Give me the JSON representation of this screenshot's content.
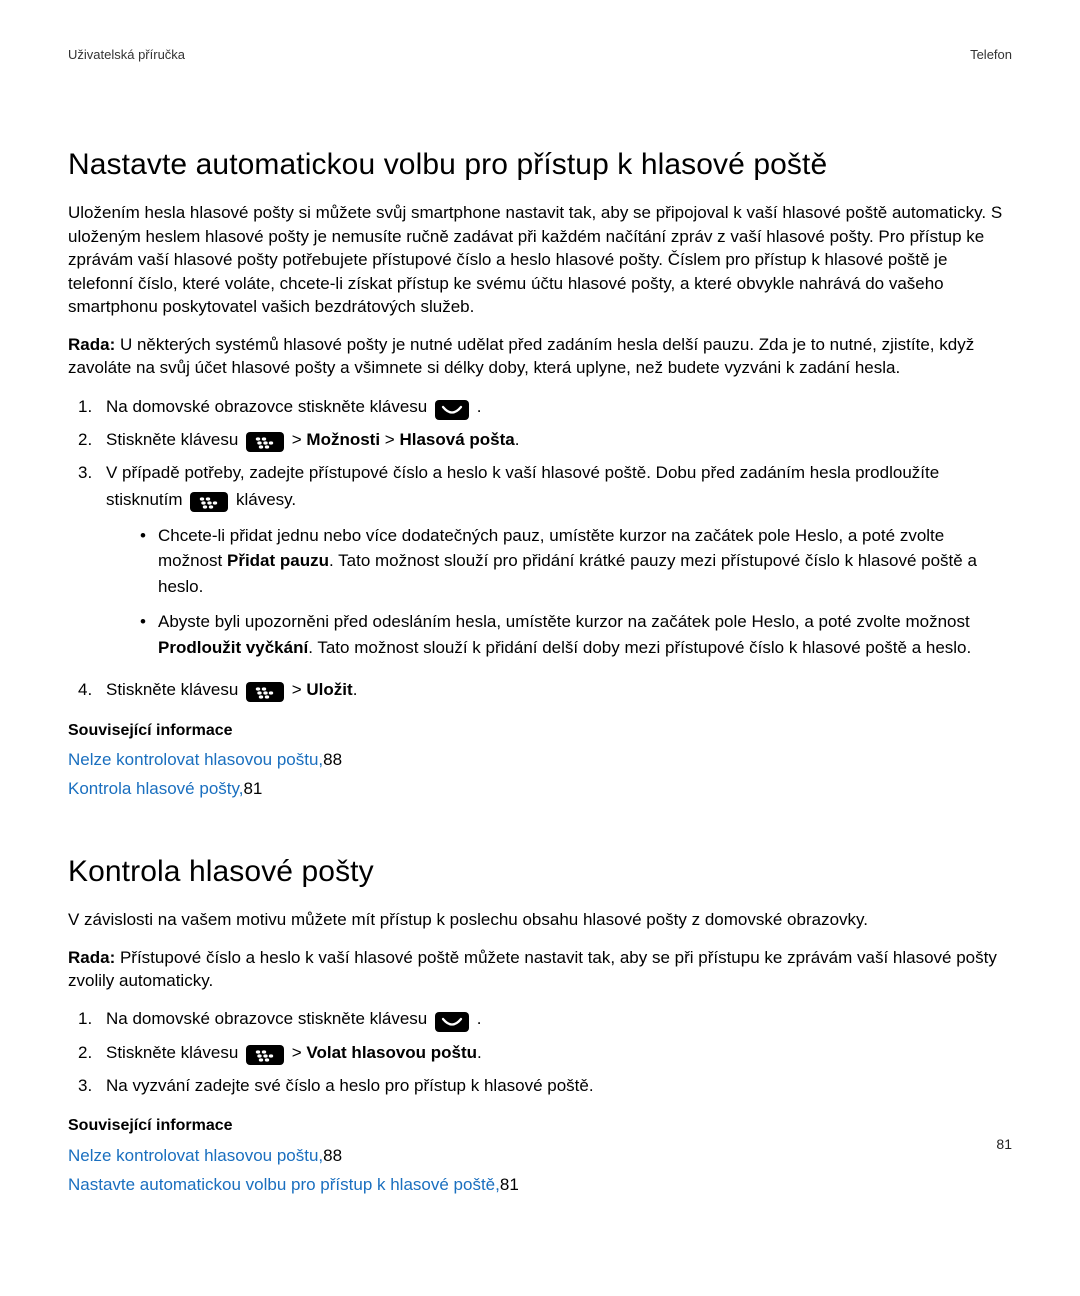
{
  "header": {
    "left": "Uživatelská příručka",
    "right": "Telefon"
  },
  "section1": {
    "title": "Nastavte automatickou volbu pro přístup k hlasové poště",
    "para1": "Uložením hesla hlasové pošty si můžete svůj smartphone nastavit tak, aby se připojoval k vaší hlasové poště automaticky. S uloženým heslem hlasové pošty je nemusíte ručně zadávat při každém načítání zpráv z vaší hlasové pošty. Pro přístup ke zprávám vaší hlasové pošty potřebujete přístupové číslo a heslo hlasové pošty. Číslem pro přístup k hlasové poště je telefonní číslo, které voláte, chcete-li získat přístup ke svému účtu hlasové pošty, a které obvykle nahrává do vašeho smartphonu poskytovatel vašich bezdrátových služeb.",
    "tip_label": "Rada:",
    "tip_text": " U některých systémů hlasové pošty je nutné udělat před zadáním hesla delší pauzu. Zda je to nutné, zjistíte, když zavoláte na svůj účet hlasové pošty a všimnete si délky doby, která uplyne, než budete vyzváni k zadání hesla.",
    "step1": "Na domovské obrazovce stiskněte klávesu ",
    "step2_a": "Stiskněte klávesu ",
    "step2_b": " > ",
    "step2_opt": "Možnosti",
    "step2_b2": " > ",
    "step2_opt2": "Hlasová pošta",
    "step2_end": ".",
    "step3_a": "V případě potřeby, zadejte přístupové číslo a heslo k vaší hlasové poště. Dobu před zadáním hesla prodloužíte stisknutím ",
    "step3_b": " klávesy.",
    "sub1_a": "Chcete-li přidat jednu nebo více dodatečných pauz, umístěte kurzor na začátek pole Heslo, a poté zvolte možnost ",
    "sub1_bold": "Přidat pauzu",
    "sub1_b": ". Tato možnost slouží pro přidání krátké pauzy mezi přístupové číslo k hlasové poště a heslo.",
    "sub2_a": "Abyste byli upozorněni před odesláním hesla, umístěte kurzor na začátek pole Heslo, a poté zvolte možnost ",
    "sub2_bold": "Prodloužit vyčkání",
    "sub2_b": ". Tato možnost slouží k přidání delší doby mezi přístupové číslo k hlasové poště a heslo.",
    "step4_a": "Stiskněte klávesu ",
    "step4_b": " > ",
    "step4_bold": "Uložit",
    "step4_end": ".",
    "related": "Související informace",
    "link1_text": "Nelze kontrolovat hlasovou poštu,",
    "link1_page": "88",
    "link2_text": "Kontrola hlasové pošty,",
    "link2_page": "81"
  },
  "section2": {
    "title": "Kontrola hlasové pošty",
    "para1": "V závislosti na vašem motivu můžete mít přístup k poslechu obsahu hlasové pošty z domovské obrazovky.",
    "tip_label": "Rada:",
    "tip_text": " Přístupové číslo a heslo k vaší hlasové poště můžete nastavit tak, aby se při přístupu ke zprávám vaší hlasové pošty zvolily automaticky.",
    "step1": "Na domovské obrazovce stiskněte klávesu ",
    "step2_a": "Stiskněte klávesu ",
    "step2_b": " > ",
    "step2_bold": "Volat hlasovou poštu",
    "step2_end": ".",
    "step3": "Na vyzvání zadejte své číslo a heslo pro přístup k hlasové poště.",
    "related": "Související informace",
    "link1_text": "Nelze kontrolovat hlasovou poštu,",
    "link1_page": "88",
    "link2_text": "Nastavte automatickou volbu pro přístup k hlasové poště,",
    "link2_page": "81"
  },
  "page_number": "81",
  "period": "."
}
